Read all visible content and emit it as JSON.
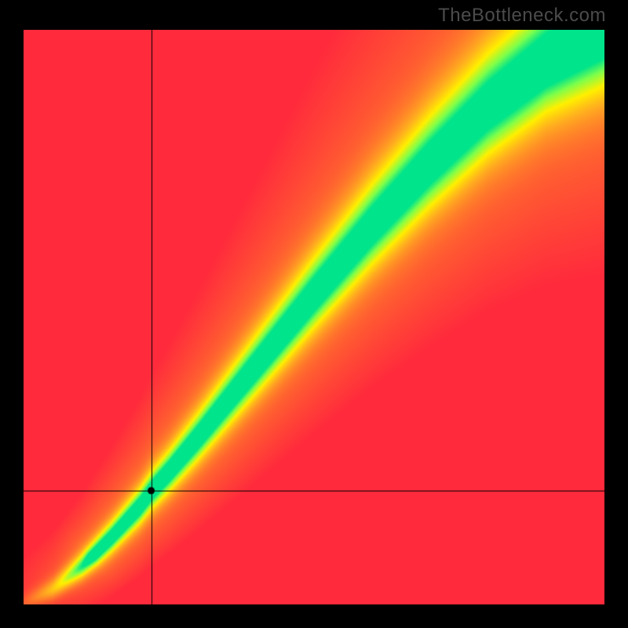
{
  "watermark": "TheBottleneck.com",
  "chart_data": {
    "type": "heatmap",
    "title": "",
    "xlabel": "",
    "ylabel": "",
    "xlim": [
      0,
      100
    ],
    "ylim": [
      0,
      100
    ],
    "grid": false,
    "legend": false,
    "annotations": [],
    "colormap": {
      "description": "Value 0 = red, 0.5 = yellow, 1.0 = green; radial falloff to red at corners",
      "stops": [
        {
          "value": 0.0,
          "color": "#ff2a3c"
        },
        {
          "value": 0.45,
          "color": "#ffae1f"
        },
        {
          "value": 0.65,
          "color": "#fff000"
        },
        {
          "value": 0.85,
          "color": "#7cff4c"
        },
        {
          "value": 1.0,
          "color": "#00e48b"
        }
      ]
    },
    "ideal_curve_xy": [
      [
        0,
        0
      ],
      [
        5,
        2.5
      ],
      [
        10,
        6.5
      ],
      [
        15,
        11.5
      ],
      [
        20,
        17
      ],
      [
        22,
        19.7
      ],
      [
        25,
        23
      ],
      [
        30,
        29
      ],
      [
        40,
        41.5
      ],
      [
        50,
        54
      ],
      [
        60,
        66
      ],
      [
        70,
        77
      ],
      [
        80,
        87
      ],
      [
        90,
        95
      ],
      [
        100,
        100
      ]
    ],
    "green_band_halfwidth_pct": 4.0,
    "marker": {
      "x": 22,
      "y": 19.7
    },
    "crosshair": {
      "x": 22,
      "y": 19.7,
      "full_width": true,
      "full_height": true,
      "color": "#000000"
    }
  }
}
